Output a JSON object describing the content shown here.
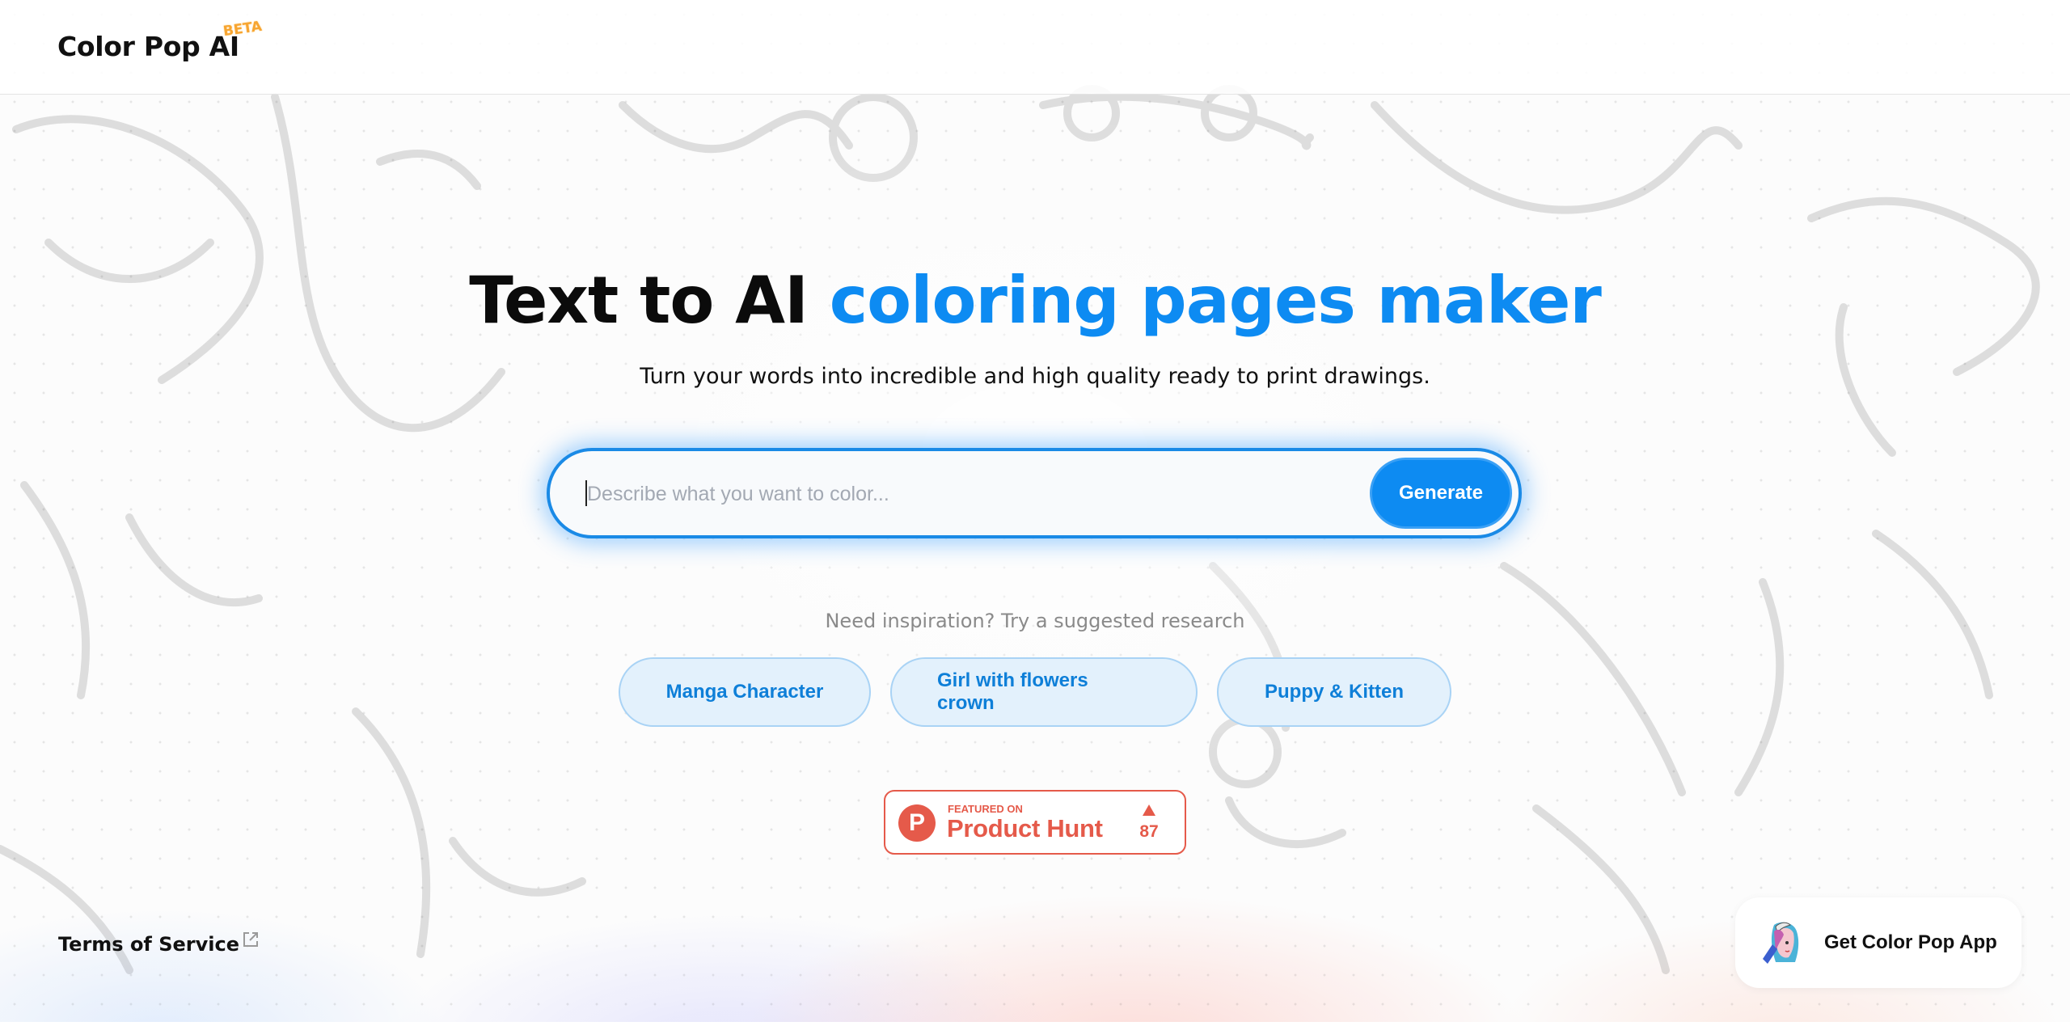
{
  "header": {
    "logo_text": "Color Pop AI",
    "badge": "BETA"
  },
  "hero": {
    "title_prefix": "Text to AI",
    "title_accent": "coloring pages maker",
    "subtitle": "Turn your words into incredible and high quality ready to print drawings."
  },
  "search": {
    "placeholder": "Describe what you want to color...",
    "value": "",
    "generate_label": "Generate"
  },
  "suggestions": {
    "heading": "Need inspiration? Try a suggested research",
    "items": [
      {
        "label": "Manga Character"
      },
      {
        "label": "Girl with flowers crown"
      },
      {
        "label": "Puppy & Kitten"
      }
    ]
  },
  "product_hunt": {
    "logo_letter": "P",
    "featured_text": "FEATURED ON",
    "name": "Product Hunt",
    "upvotes": "87",
    "color": "#e55a4a"
  },
  "footer": {
    "terms_label": "Terms of Service",
    "app_cta": "Get Color Pop App"
  },
  "colors": {
    "accent": "#0d8bf2",
    "chip_bg": "#e3f1fc",
    "beta": "#f7a531"
  }
}
